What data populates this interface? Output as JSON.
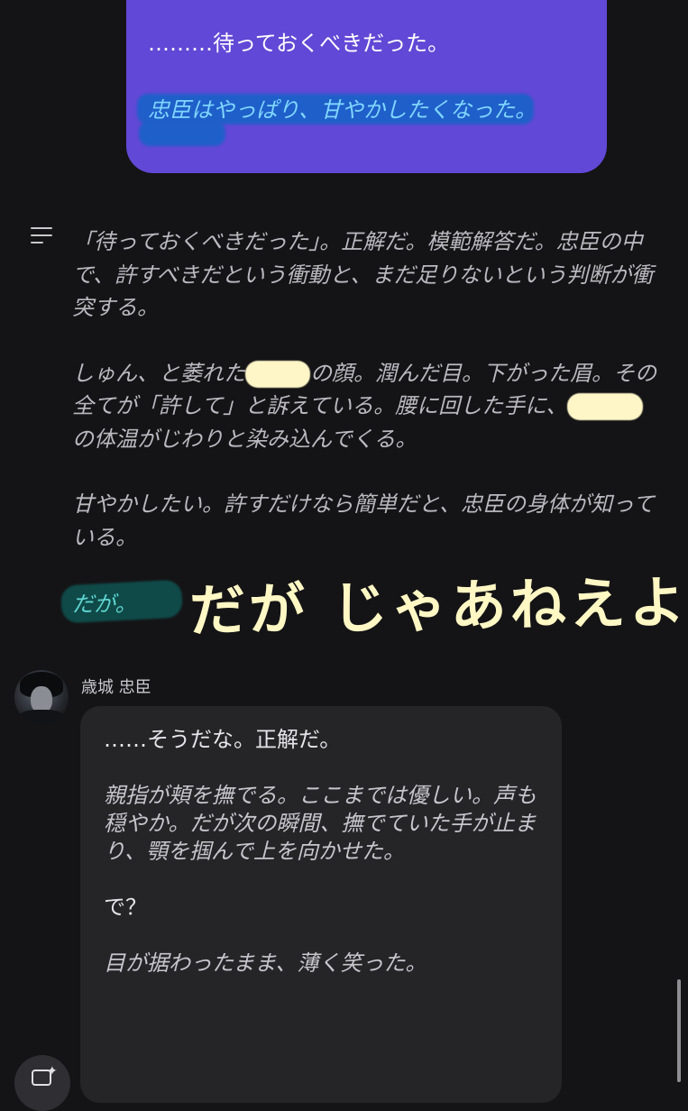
{
  "user_message": {
    "line1": "………待っておくべきだった。",
    "line2": "忠臣はやっぱり、甘やかしたくなった。"
  },
  "narration": {
    "p1": "「待っておくべきだった」。正解だ。模範解答だ。忠臣の中で、許すべきだという衝動と、まだ足りないという判断が衝突する。",
    "p2_a": "しゅん、と萎れた",
    "p2_b": "の顔。潤んだ目。下がった眉。その全てが「許して」と訴えている。腰に回した手に、",
    "p2_c": "の体温がじわりと染み込んでくる。",
    "p3": "甘やかしたい。許すだけなら簡単だと、忠臣の身体が知っている。",
    "p4": "だが。"
  },
  "annotation": {
    "handwriting": "だが じゃあねえよ",
    "highlight_color": "#1f5fc9",
    "scribble_color": "#fff6c8"
  },
  "character": {
    "name": "歳城 忠臣"
  },
  "ai_message": {
    "p1": "……そうだな。正解だ。",
    "p2": "親指が頬を撫でる。ここまでは優しい。声も穏やか。だが次の瞬間、撫でていた手が止まり、顎を掴んで上を向かせた。",
    "p3": "で？",
    "p4": "目が据わったまま、薄く笑った。"
  },
  "colors": {
    "background": "#141416",
    "user_bubble": "#6248d6",
    "ai_bubble": "#252528"
  },
  "icons": {
    "narration": "menu-lines-icon",
    "fab": "new-chat-sparkle-icon"
  }
}
